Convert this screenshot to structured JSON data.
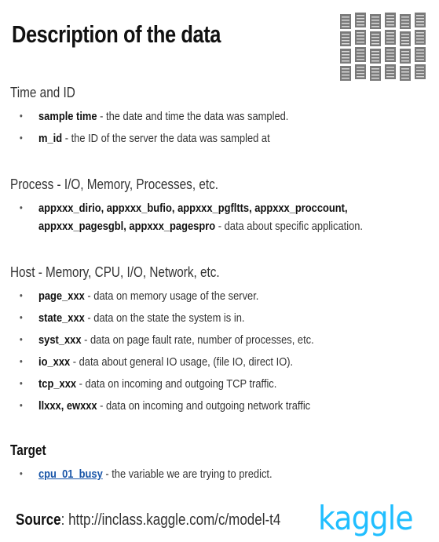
{
  "title": "Description of the data",
  "sections": {
    "time": {
      "heading": "Time and ID",
      "items": [
        {
          "term": "sample time",
          "desc": " - the date and time the data was sampled."
        },
        {
          "term": "m_id",
          "desc": " - the ID of the server the data was sampled at"
        }
      ]
    },
    "process": {
      "heading": "Process - I/O, Memory, Processes, etc.",
      "line1_term": "appxxx_dirio, appxxx_bufio, appxxx_pgfltts, appxxx_proccount,",
      "line2_term": "appxxx_pagesgbl, appxxx_pagespro",
      "line2_desc": "  - data about specific application."
    },
    "host": {
      "heading": "Host - Memory, CPU, I/O, Network, etc.",
      "items": [
        {
          "term": "page_xxx",
          "desc": " - data on memory usage of the server."
        },
        {
          "term": "state_xxx",
          "desc": " - data on the state the system is in."
        },
        {
          "term": "syst_xxx",
          "desc": " - data on page fault rate, number of processes, etc."
        },
        {
          "term": "io_xxx",
          "desc": " - data about general IO usage, (file IO, direct IO)."
        },
        {
          "term": "tcp_xxx",
          "desc": " - data on incoming and outgoing TCP traffic."
        },
        {
          "term": "llxxx, ewxxx",
          "desc": " - data on incoming and outgoing network traffic"
        }
      ]
    },
    "target": {
      "heading": "Target",
      "term": "cpu_01_busy",
      "desc": " - the variable we are trying to predict."
    }
  },
  "source": {
    "label": "Source",
    "text": ": http://inclass.kaggle.com/c/model-t4"
  },
  "logo": {
    "text": "kaggle",
    "color": "#20beff",
    "icon": "kaggle-logo"
  },
  "illustration": {
    "icon": "server-rack-icon",
    "color": "#7a7a7a"
  }
}
